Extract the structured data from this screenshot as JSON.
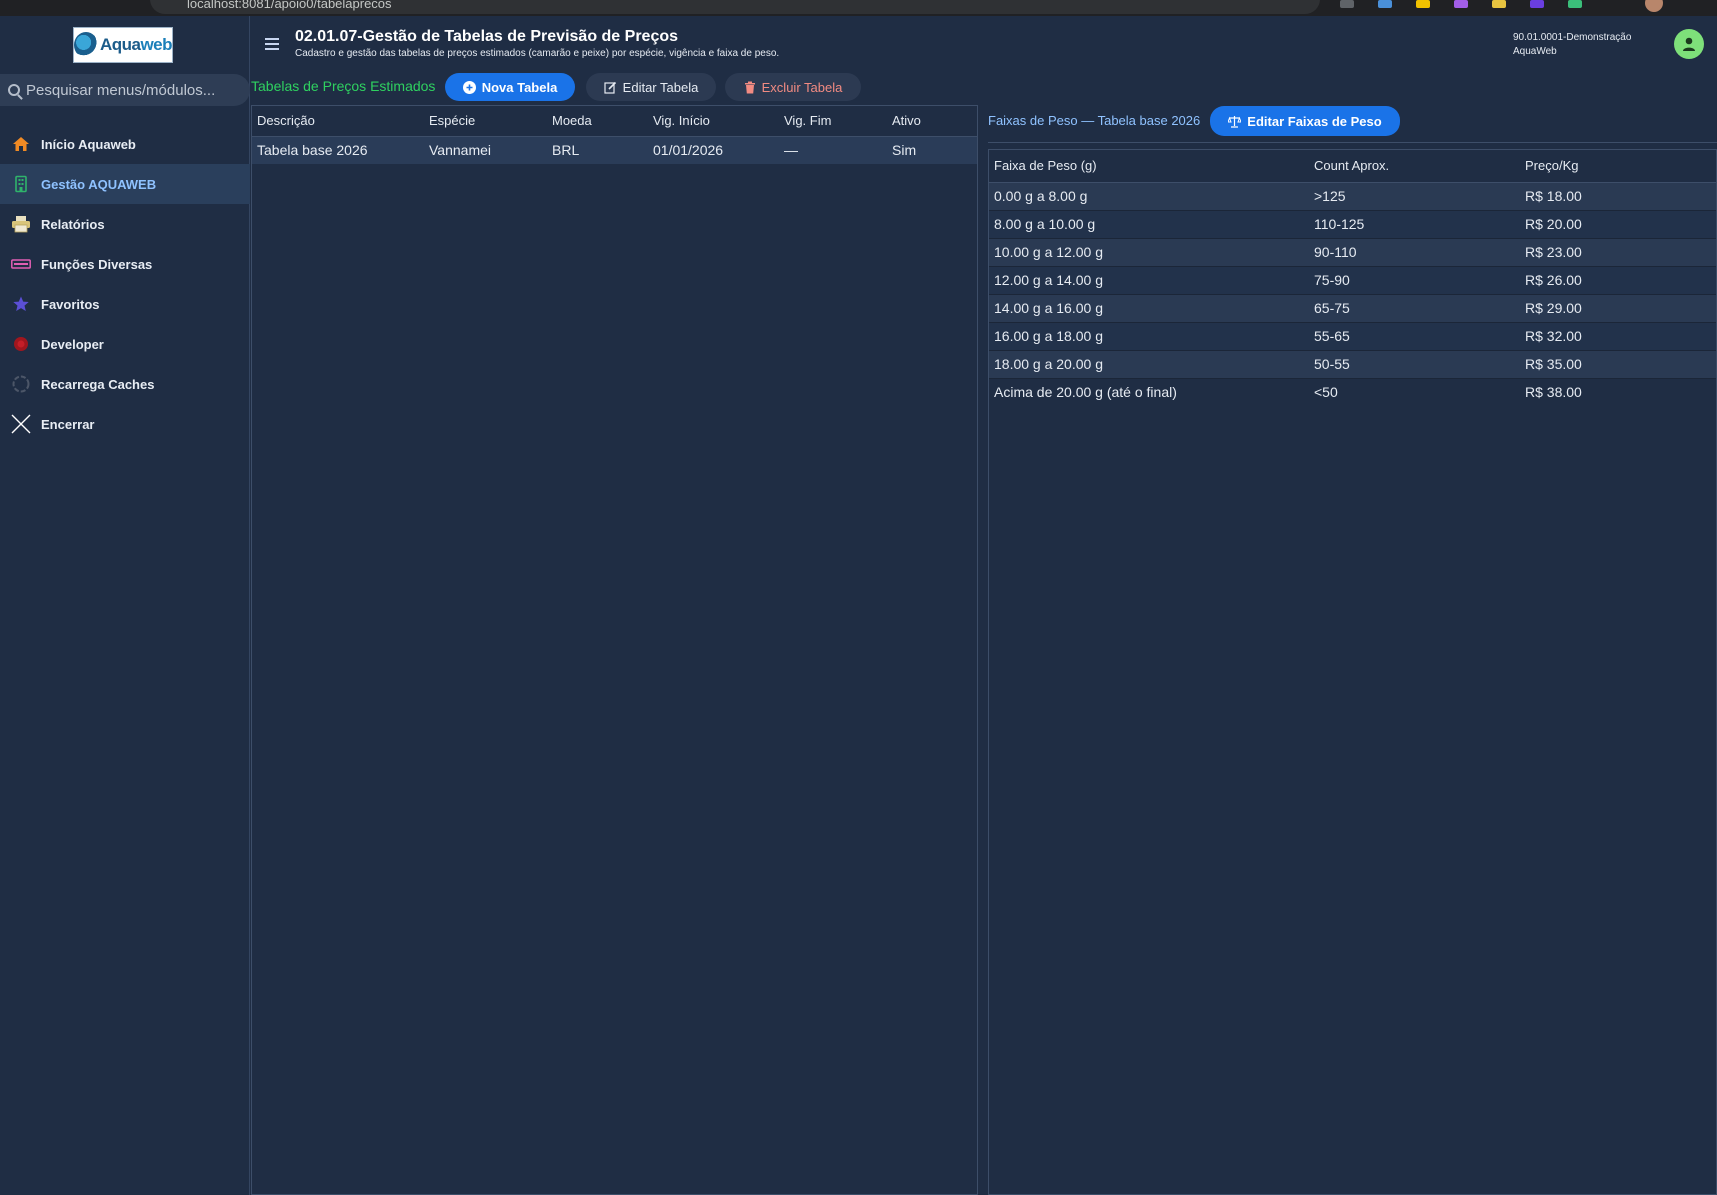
{
  "browser": {
    "url": "localhost:8081/apoio0/tabelaprecos"
  },
  "sidebar": {
    "logo_text_a": "Aqua",
    "logo_text_b": "web",
    "search_placeholder": "Pesquisar menus/módulos...",
    "items": [
      {
        "label": "Início Aquaweb",
        "icon": "home-icon",
        "color": "#f08a24"
      },
      {
        "label": "Gestão AQUAWEB",
        "icon": "building-icon",
        "color": "#2fb36b",
        "active": true
      },
      {
        "label": "Relatórios",
        "icon": "printer-icon",
        "color": "#d8c47a"
      },
      {
        "label": "Funções Diversas",
        "icon": "keyboard-icon",
        "color": "#e05fb3"
      },
      {
        "label": "Favoritos",
        "icon": "star-icon",
        "color": "#5b4fd6"
      },
      {
        "label": "Developer",
        "icon": "bug-icon",
        "color": "#a0161e"
      },
      {
        "label": "Recarrega Caches",
        "icon": "refresh-icon",
        "color": "#6b7686"
      },
      {
        "label": "Encerrar",
        "icon": "close-icon",
        "color": "#ffffff"
      }
    ]
  },
  "header": {
    "title": "02.01.07-Gestão de Tabelas de Previsão de Preços",
    "subtitle": "Cadastro e gestão das tabelas de preços estimados (camarão e peixe) por espécie, vigência e faixa de peso.",
    "user_line1": "90.01.0001-Demonstração",
    "user_line2": "AquaWeb"
  },
  "left": {
    "section_label": "Tabelas de Preços Estimados",
    "new_button": "Nova Tabela",
    "edit_button": "Editar Tabela",
    "delete_button": "Excluir Tabela",
    "columns": [
      "Descrição",
      "Espécie",
      "Moeda",
      "Vig. Início",
      "Vig. Fim",
      "Ativo"
    ],
    "rows": [
      [
        "Tabela base 2026",
        "Vannamei",
        "BRL",
        "01/01/2026",
        "—",
        "Sim"
      ]
    ]
  },
  "right": {
    "section_label": "Faixas de Peso — Tabela base 2026",
    "edit_button": "Editar Faixas de Peso",
    "columns": [
      "Faixa de Peso (g)",
      "Count Aprox.",
      "Preço/Kg"
    ],
    "rows": [
      [
        "0.00 g a 8.00 g",
        ">125",
        "R$ 18.00"
      ],
      [
        "8.00 g a 10.00 g",
        "110-125",
        "R$ 20.00"
      ],
      [
        "10.00 g a 12.00 g",
        "90-110",
        "R$ 23.00"
      ],
      [
        "12.00 g a 14.00 g",
        "75-90",
        "R$ 26.00"
      ],
      [
        "14.00 g a 16.00 g",
        "65-75",
        "R$ 29.00"
      ],
      [
        "16.00 g a 18.00 g",
        "55-65",
        "R$ 32.00"
      ],
      [
        "18.00 g a 20.00 g",
        "50-55",
        "R$ 35.00"
      ],
      [
        "Acima de 20.00 g (até o final)",
        "<50",
        "R$ 38.00"
      ]
    ]
  }
}
